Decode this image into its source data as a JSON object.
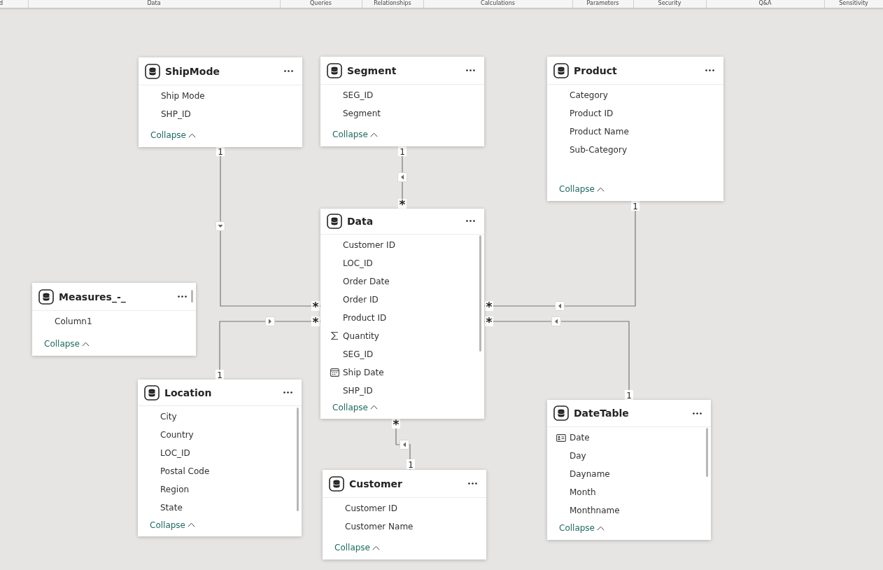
{
  "ribbon": {
    "groups": [
      "d",
      "Data",
      "Queries",
      "Relationships",
      "Calculations",
      "Parameters",
      "Security",
      "Q&A",
      "Sensitivity"
    ]
  },
  "tables": [
    {
      "name": "ShipMode",
      "scrollbar": false,
      "collapse": "Collapse",
      "columns": [
        {
          "name": "Ship Mode",
          "kind": "plain"
        },
        {
          "name": "SHP_ID",
          "kind": "plain"
        }
      ]
    },
    {
      "name": "Segment",
      "scrollbar": false,
      "collapse": "Collapse",
      "columns": [
        {
          "name": "SEG_ID",
          "kind": "plain"
        },
        {
          "name": "Segment",
          "kind": "plain"
        }
      ]
    },
    {
      "name": "Product",
      "scrollbar": false,
      "collapse": "Collapse",
      "columns": [
        {
          "name": "Category",
          "kind": "plain"
        },
        {
          "name": "Product ID",
          "kind": "plain"
        },
        {
          "name": "Product Name",
          "kind": "plain"
        },
        {
          "name": "Sub-Category",
          "kind": "plain"
        }
      ]
    },
    {
      "name": "Data",
      "scrollbar": true,
      "collapse": "Collapse",
      "columns": [
        {
          "name": "Customer ID",
          "kind": "plain"
        },
        {
          "name": "LOC_ID",
          "kind": "plain"
        },
        {
          "name": "Order Date",
          "kind": "plain"
        },
        {
          "name": "Order ID",
          "kind": "plain"
        },
        {
          "name": "Product ID",
          "kind": "plain"
        },
        {
          "name": "Quantity",
          "kind": "sum"
        },
        {
          "name": "SEG_ID",
          "kind": "plain"
        },
        {
          "name": "Ship Date",
          "kind": "calendar"
        },
        {
          "name": "SHP_ID",
          "kind": "plain"
        }
      ]
    },
    {
      "name": "Measures_-_",
      "scrollbar": true,
      "collapse": "Collapse",
      "columns": [
        {
          "name": "Column1",
          "kind": "plain"
        }
      ]
    },
    {
      "name": "Location",
      "scrollbar": true,
      "collapse": "Collapse",
      "columns": [
        {
          "name": "City",
          "kind": "plain"
        },
        {
          "name": "Country",
          "kind": "plain"
        },
        {
          "name": "LOC_ID",
          "kind": "plain"
        },
        {
          "name": "Postal Code",
          "kind": "plain"
        },
        {
          "name": "Region",
          "kind": "plain"
        },
        {
          "name": "State",
          "kind": "plain"
        }
      ]
    },
    {
      "name": "Customer",
      "scrollbar": false,
      "collapse": "Collapse",
      "columns": [
        {
          "name": "Customer ID",
          "kind": "plain"
        },
        {
          "name": "Customer Name",
          "kind": "plain"
        }
      ]
    },
    {
      "name": "DateTable",
      "scrollbar": true,
      "collapse": "Collapse",
      "columns": [
        {
          "name": "Date",
          "kind": "key"
        },
        {
          "name": "Day",
          "kind": "plain"
        },
        {
          "name": "Dayname",
          "kind": "plain"
        },
        {
          "name": "Month",
          "kind": "plain"
        },
        {
          "name": "Monthname",
          "kind": "plain"
        }
      ]
    }
  ],
  "relationships": [
    {
      "one_label": "1",
      "many_label": "*",
      "kind": "down"
    },
    {
      "one_label": "1",
      "many_label": "*",
      "kind": "left"
    },
    {
      "one_label": "1",
      "many_label": "*",
      "kind": "left"
    },
    {
      "one_label": "1",
      "many_label": "*",
      "kind": "right"
    },
    {
      "one_label": "1",
      "many_label": "*",
      "kind": "left"
    },
    {
      "one_label": "1",
      "many_label": "*",
      "kind": "left"
    }
  ]
}
